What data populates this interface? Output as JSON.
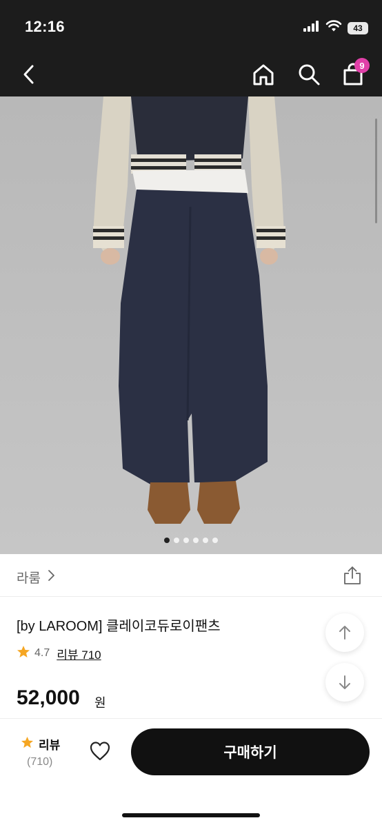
{
  "status": {
    "time": "12:16",
    "battery": "43",
    "icons": [
      "cellular-signal-icon",
      "wifi-icon",
      "battery-icon"
    ]
  },
  "nav": {
    "icons": [
      "back-chevron-icon",
      "home-icon",
      "search-icon",
      "shopping-bag-icon"
    ],
    "cart_count": "9",
    "badge_color": "#e040a8"
  },
  "gallery": {
    "image_count": 6,
    "active_index": 0
  },
  "brand": {
    "name": "라룸",
    "chevron": "›"
  },
  "product": {
    "title": "[by LAROOM] 클레이코듀로이팬츠",
    "rating": "4.7",
    "review_link": "리뷰 710",
    "price": "52,000",
    "currency": "원",
    "star_color": "#f5a623"
  },
  "bottom_bar": {
    "review_label": "리뷰",
    "review_count": "(710)",
    "buy_label": "구매하기"
  }
}
